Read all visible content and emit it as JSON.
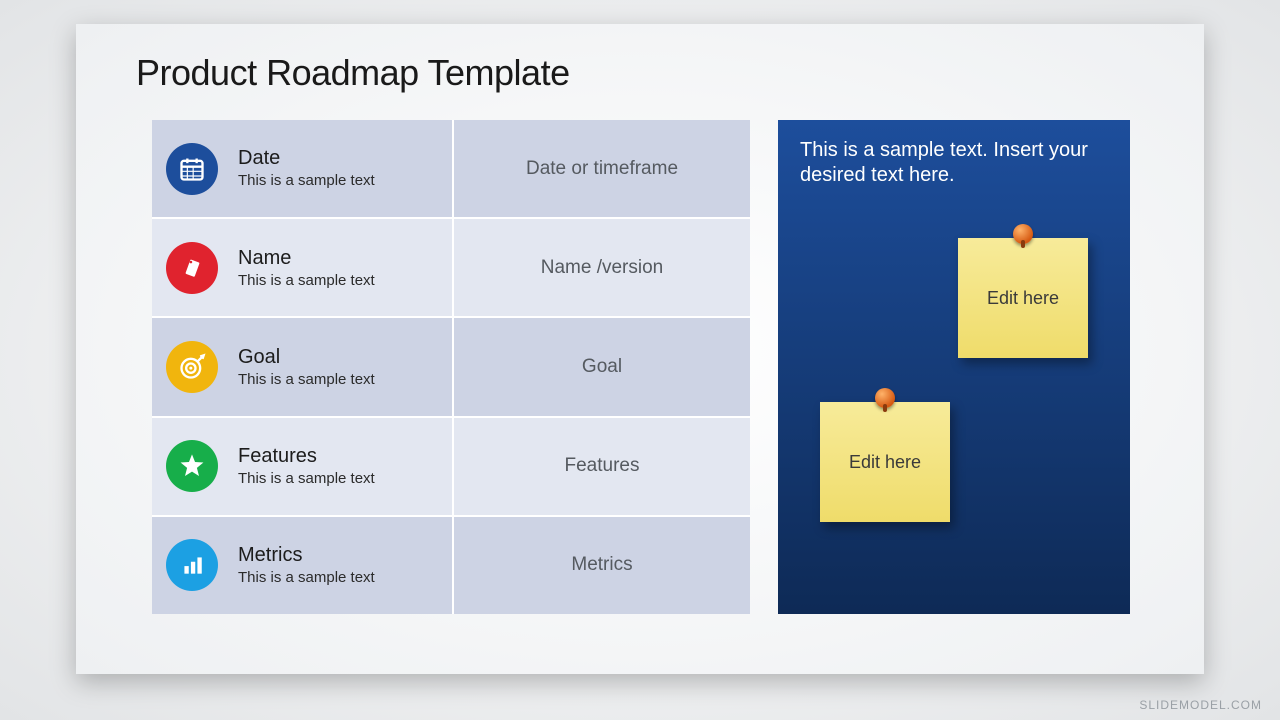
{
  "title": "Product Roadmap Template",
  "rows": [
    {
      "icon": "calendar-icon",
      "color": "#1d4e9c",
      "label": "Date",
      "sub": "This is a sample text",
      "value": "Date or timeframe"
    },
    {
      "icon": "tag-icon",
      "color": "#e0232e",
      "label": "Name",
      "sub": "This is a sample text",
      "value": "Name /version"
    },
    {
      "icon": "target-icon",
      "color": "#f1b50d",
      "label": "Goal",
      "sub": "This is a sample text",
      "value": "Goal"
    },
    {
      "icon": "star-icon",
      "color": "#17ae4a",
      "label": "Features",
      "sub": "This is a sample text",
      "value": "Features"
    },
    {
      "icon": "chart-icon",
      "color": "#1ca0e3",
      "label": "Metrics",
      "sub": "This is a sample text",
      "value": "Metrics"
    }
  ],
  "panel": {
    "text": "This is a sample text. Insert your desired text here.",
    "sticky1": "Edit here",
    "sticky2": "Edit here"
  },
  "watermark": "SLIDEMODEL.COM"
}
